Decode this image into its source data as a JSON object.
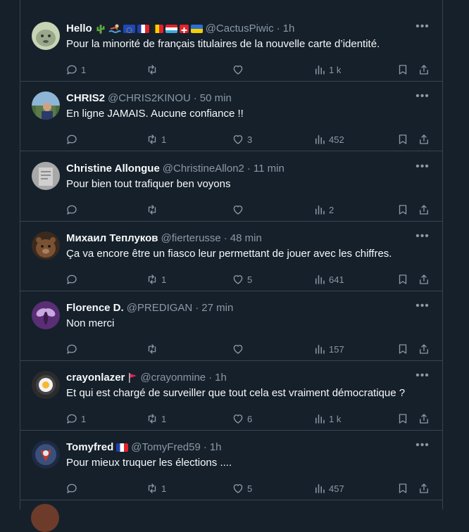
{
  "tweets": [
    {
      "name": "Hello",
      "handle": "@CactusPiwic",
      "time": "1h",
      "text": "Pour la minorité de français titulaires de la nouvelle carte d’identité.",
      "replies": "1",
      "retweets": "",
      "likes": "",
      "views": "1 k",
      "avatar_color": "#b9c9a6",
      "emojis": [
        "cactus",
        "swimmer",
        "flag-eu",
        "flag-france",
        "flag-belgium",
        "flag-luxembourg",
        "flag-switzerland",
        "flag-ukraine"
      ]
    },
    {
      "name": "CHRIS2",
      "handle": "@CHRIS2KINOU",
      "time": "50 min",
      "text": "En ligne JAMAIS. Aucune confiance !!",
      "replies": "",
      "retweets": "1",
      "likes": "3",
      "views": "452",
      "avatar_color": "#5c7c9a"
    },
    {
      "name": "Christine Allongue",
      "handle": "@ChristineAllon2",
      "time": "11 min",
      "text": "Pour bien tout trafiquer ben voyons",
      "replies": "",
      "retweets": "",
      "likes": "",
      "views": "2",
      "avatar_color": "#9a9a9a"
    },
    {
      "name": "Михаил Теплуков",
      "handle": "@fierterusse",
      "time": "48 min",
      "text": "Ça va encore être un fiasco leur permettant de jouer avec les chiffres.",
      "replies": "",
      "retweets": "1",
      "likes": "5",
      "views": "641",
      "avatar_color": "#6b4a2f"
    },
    {
      "name": "Florence D.",
      "handle": "@PREDIGAN",
      "time": "27 min",
      "text": "Non merci",
      "replies": "",
      "retweets": "",
      "likes": "",
      "views": "157",
      "avatar_color": "#7d4a9c"
    },
    {
      "name": "crayonlazer",
      "handle": "@crayonmine",
      "time": "1h",
      "text": "Et qui est chargé de surveiller que tout cela est vraiment démocratique ?",
      "replies": "1",
      "retweets": "1",
      "likes": "6",
      "views": "1 k",
      "avatar_color": "#2e2e2e",
      "emojis": [
        "triangular-flag"
      ]
    },
    {
      "name": "Tomyfred",
      "handle": "@TomyFred59",
      "time": "1h",
      "text": "Pour mieux truquer les élections ....",
      "replies": "",
      "retweets": "1",
      "likes": "5",
      "views": "457",
      "avatar_color": "#3a4a6a",
      "emojis": [
        "flag-france"
      ]
    }
  ],
  "colors": {
    "background": "#15202b",
    "border": "#38444d",
    "primary_text": "#f7f9f9",
    "secondary_text": "#8b98a5"
  }
}
